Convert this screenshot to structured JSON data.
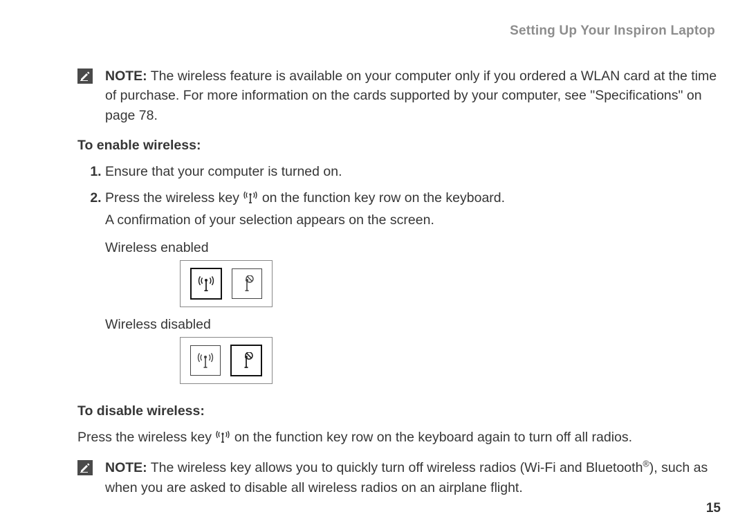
{
  "header": "Setting Up Your Inspiron Laptop",
  "note1": {
    "label": "NOTE:",
    "body": " The wireless feature is available on your computer only if you ordered a WLAN card at the time of purchase. For more information on the cards supported by your computer, see \"Specifications\" on page 78."
  },
  "enable": {
    "heading": "To enable wireless:",
    "step1": "Ensure that your computer is turned on.",
    "step2_1": "Press the wireless key ",
    "step2_2": " on the function key row on the keyboard.",
    "step2_sub": "A confirmation of your selection appears on the screen.",
    "status_on": "Wireless enabled",
    "status_off": "Wireless disabled"
  },
  "disable": {
    "heading": "To disable wireless:",
    "line_1": "Press the wireless key ",
    "line_2": " on the function key row on the keyboard again to turn off all radios."
  },
  "note2": {
    "label": "NOTE:",
    "body_a": " The wireless key allows you to quickly turn off wireless radios (Wi-Fi and Bluetooth",
    "body_b": "), such as when you are asked to disable all wireless radios on an airplane flight."
  },
  "page_number": "15",
  "sup": "®"
}
